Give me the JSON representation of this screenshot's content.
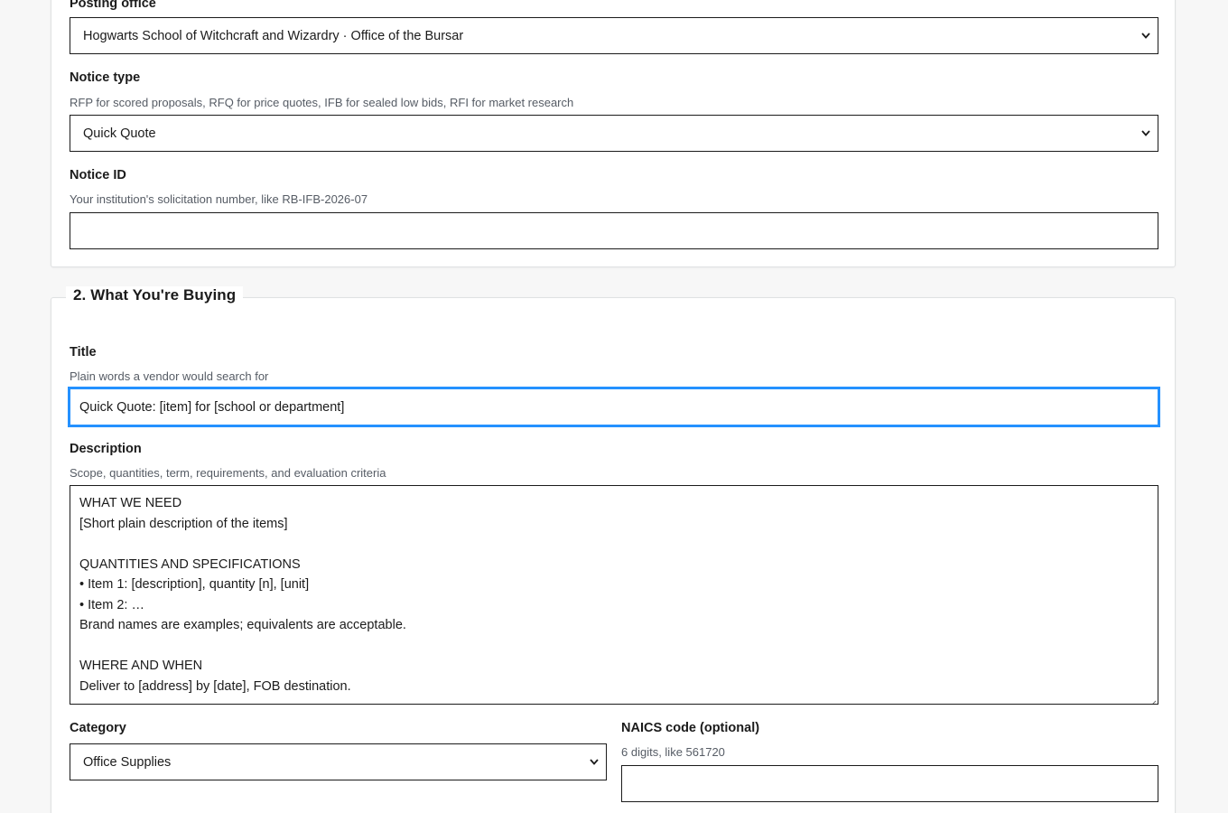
{
  "section1": {
    "posting_office": {
      "label": "Posting office",
      "value": "Hogwarts School of Witchcraft and Wizardry · Office of the Bursar"
    },
    "notice_type": {
      "label": "Notice type",
      "hint": "RFP for scored proposals, RFQ for price quotes, IFB for sealed low bids, RFI for market research",
      "value": "Quick Quote"
    },
    "notice_id": {
      "label": "Notice ID",
      "hint": "Your institution's solicitation number, like RB-IFB-2026-07",
      "value": ""
    }
  },
  "section2": {
    "legend": "2. What You're Buying",
    "title": {
      "label": "Title",
      "hint": "Plain words a vendor would search for",
      "value": "Quick Quote: [item] for [school or department]"
    },
    "description": {
      "label": "Description",
      "hint": "Scope, quantities, term, requirements, and evaluation criteria",
      "lines": [
        "WHAT WE NEED",
        "[Short plain description of the items]",
        "",
        "QUANTITIES AND SPECIFICATIONS",
        "• Item 1: [description], quantity [n], [unit]",
        "• Item 2: …",
        "Brand names are examples; equivalents are acceptable.",
        "",
        "WHERE AND WHEN",
        "Deliver to [address] by [date], FOB destination."
      ]
    },
    "category": {
      "label": "Category",
      "value": "Office Supplies"
    },
    "naics": {
      "label": "NAICS code (optional)",
      "hint": "6 digits, like 561720",
      "value": ""
    }
  },
  "colors": {
    "focus_ring": "#2491ff",
    "border": "#1b1b1b",
    "hint_text": "#565c65"
  }
}
